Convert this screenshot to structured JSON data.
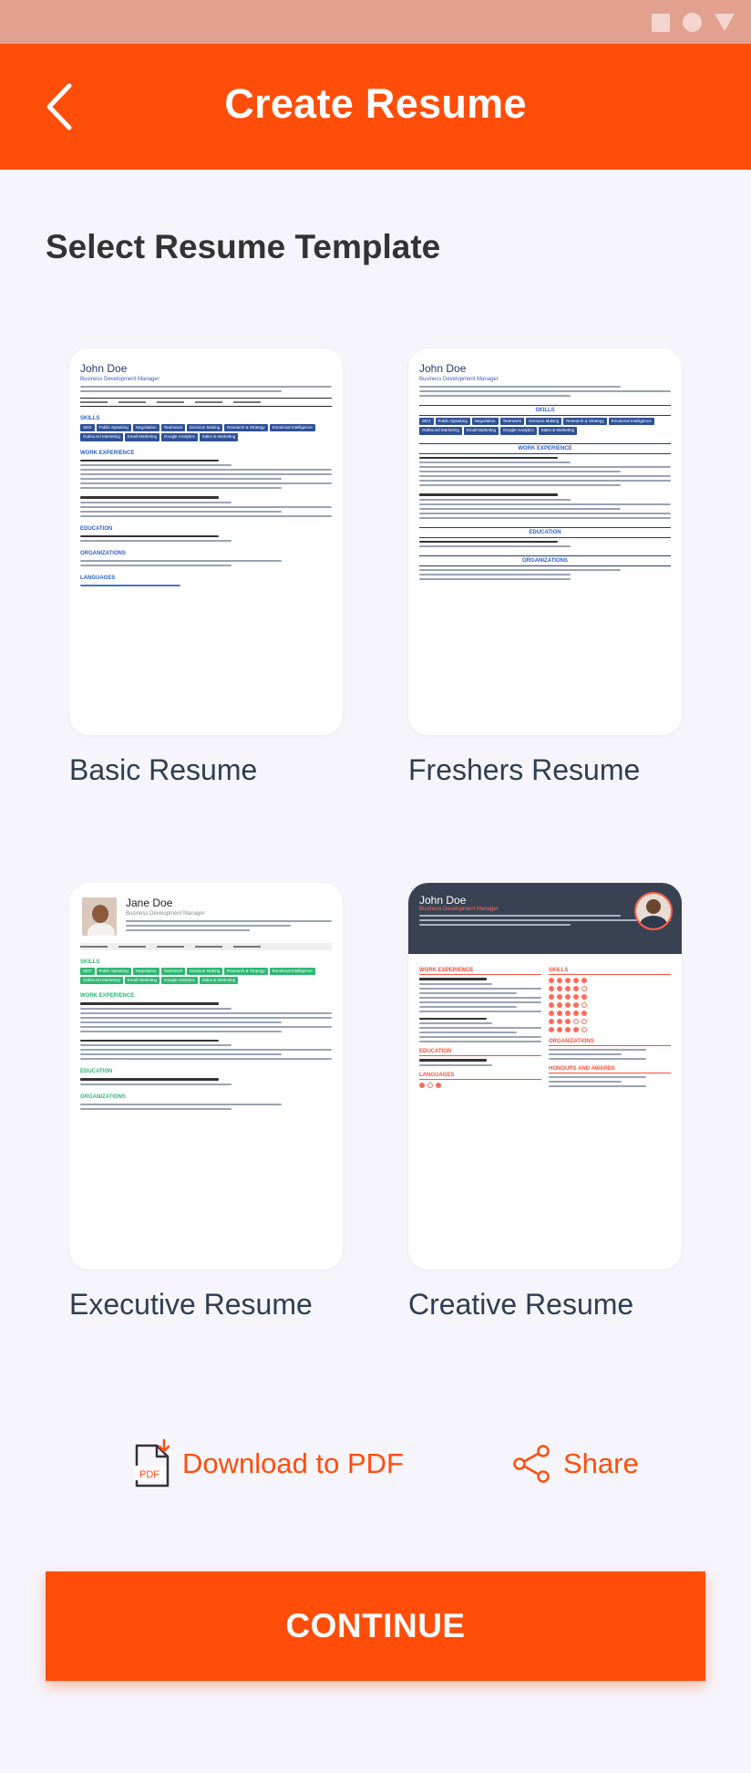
{
  "header": {
    "title": "Create Resume"
  },
  "section_title": "Select Resume Template",
  "templates": [
    {
      "label": "Basic Resume",
      "sample_name": "John Doe",
      "sample_role": "Business Development Manager"
    },
    {
      "label": "Freshers Resume",
      "sample_name": "John Doe",
      "sample_role": "Business Development Manager"
    },
    {
      "label": "Executive Resume",
      "sample_name": "Jane Doe",
      "sample_role": "Business Development Manager"
    },
    {
      "label": "Creative Resume",
      "sample_name": "John Doe",
      "sample_role": "Business Development Manager"
    }
  ],
  "preview_text": {
    "skills": "SKILLS",
    "work": "WORK EXPERIENCE",
    "education": "EDUCATION",
    "organizations": "ORGANIZATIONS",
    "languages": "LANGUAGES",
    "honours": "HONOURS AND AWARDS",
    "chips": [
      "SEO",
      "Public Speaking",
      "Negotiation",
      "Teamwork",
      "Decision Making",
      "Research & Strategy",
      "Emotional Intelligence",
      "Outbound Marketing",
      "Email Marketing",
      "Google Analytics",
      "Sales & Marketing"
    ]
  },
  "actions": {
    "download_label": "Download to PDF",
    "share_label": "Share",
    "pdf_icon_text": "PDF"
  },
  "continue_label": "CONTINUE",
  "colors": {
    "primary": "#ff4d0a",
    "status_bar": "#e2a08f",
    "background": "#f6f5fb"
  }
}
